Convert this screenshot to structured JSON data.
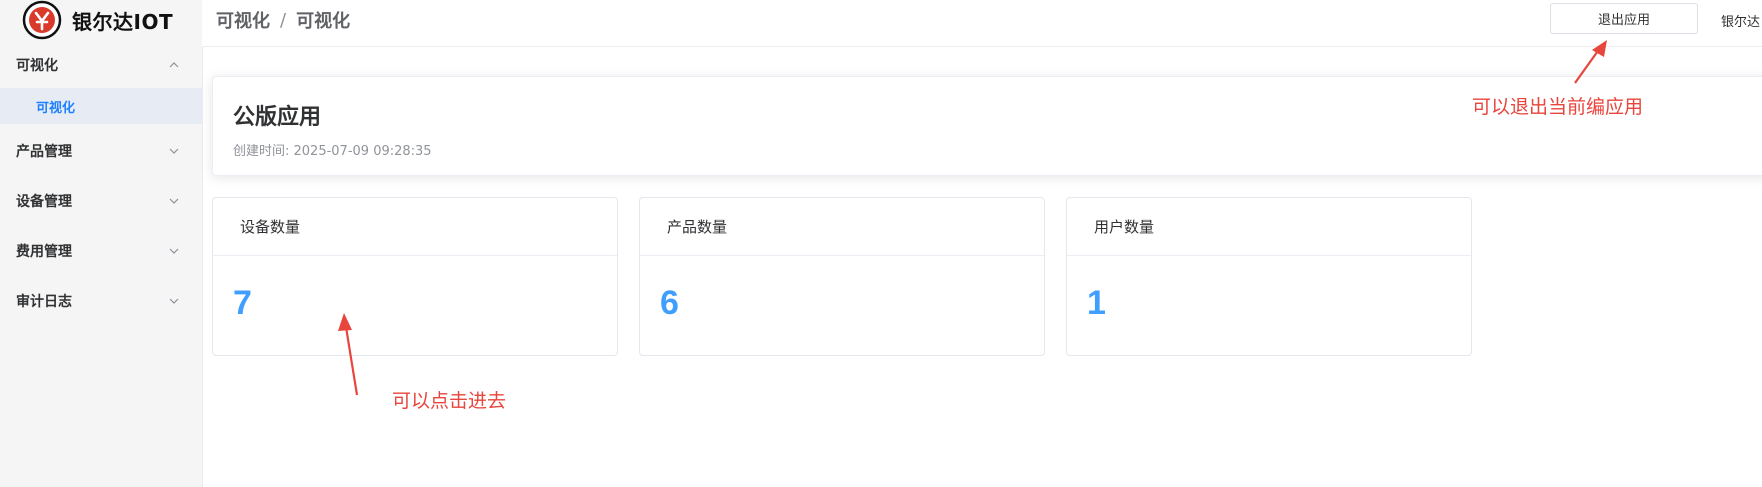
{
  "brand": {
    "name": "银尔达IOT"
  },
  "sidebar": {
    "groups": [
      {
        "label": "可视化",
        "expanded": true,
        "children": [
          {
            "label": "可视化",
            "active": true
          }
        ]
      },
      {
        "label": "产品管理",
        "expanded": false
      },
      {
        "label": "设备管理",
        "expanded": false
      },
      {
        "label": "费用管理",
        "expanded": false
      },
      {
        "label": "审计日志",
        "expanded": false
      }
    ]
  },
  "header": {
    "breadcrumb": [
      "可视化",
      "可视化"
    ],
    "breadcrumb_separator": "/",
    "exit_button": "退出应用",
    "user": "银尔达"
  },
  "app": {
    "title": "公版应用",
    "created": "创建时间: 2025-07-09 09:28:35"
  },
  "stats": [
    {
      "label": "设备数量",
      "value": "7"
    },
    {
      "label": "产品数量",
      "value": "6"
    },
    {
      "label": "用户数量",
      "value": "1"
    }
  ],
  "annotations": {
    "exit_note": "可以退出当前编应用",
    "click_note": "可以点击进去",
    "color": "#e8453c"
  },
  "colors": {
    "accent": "#409eff",
    "active_menu": "#1e80ff",
    "logo_red": "#d93a2b"
  }
}
